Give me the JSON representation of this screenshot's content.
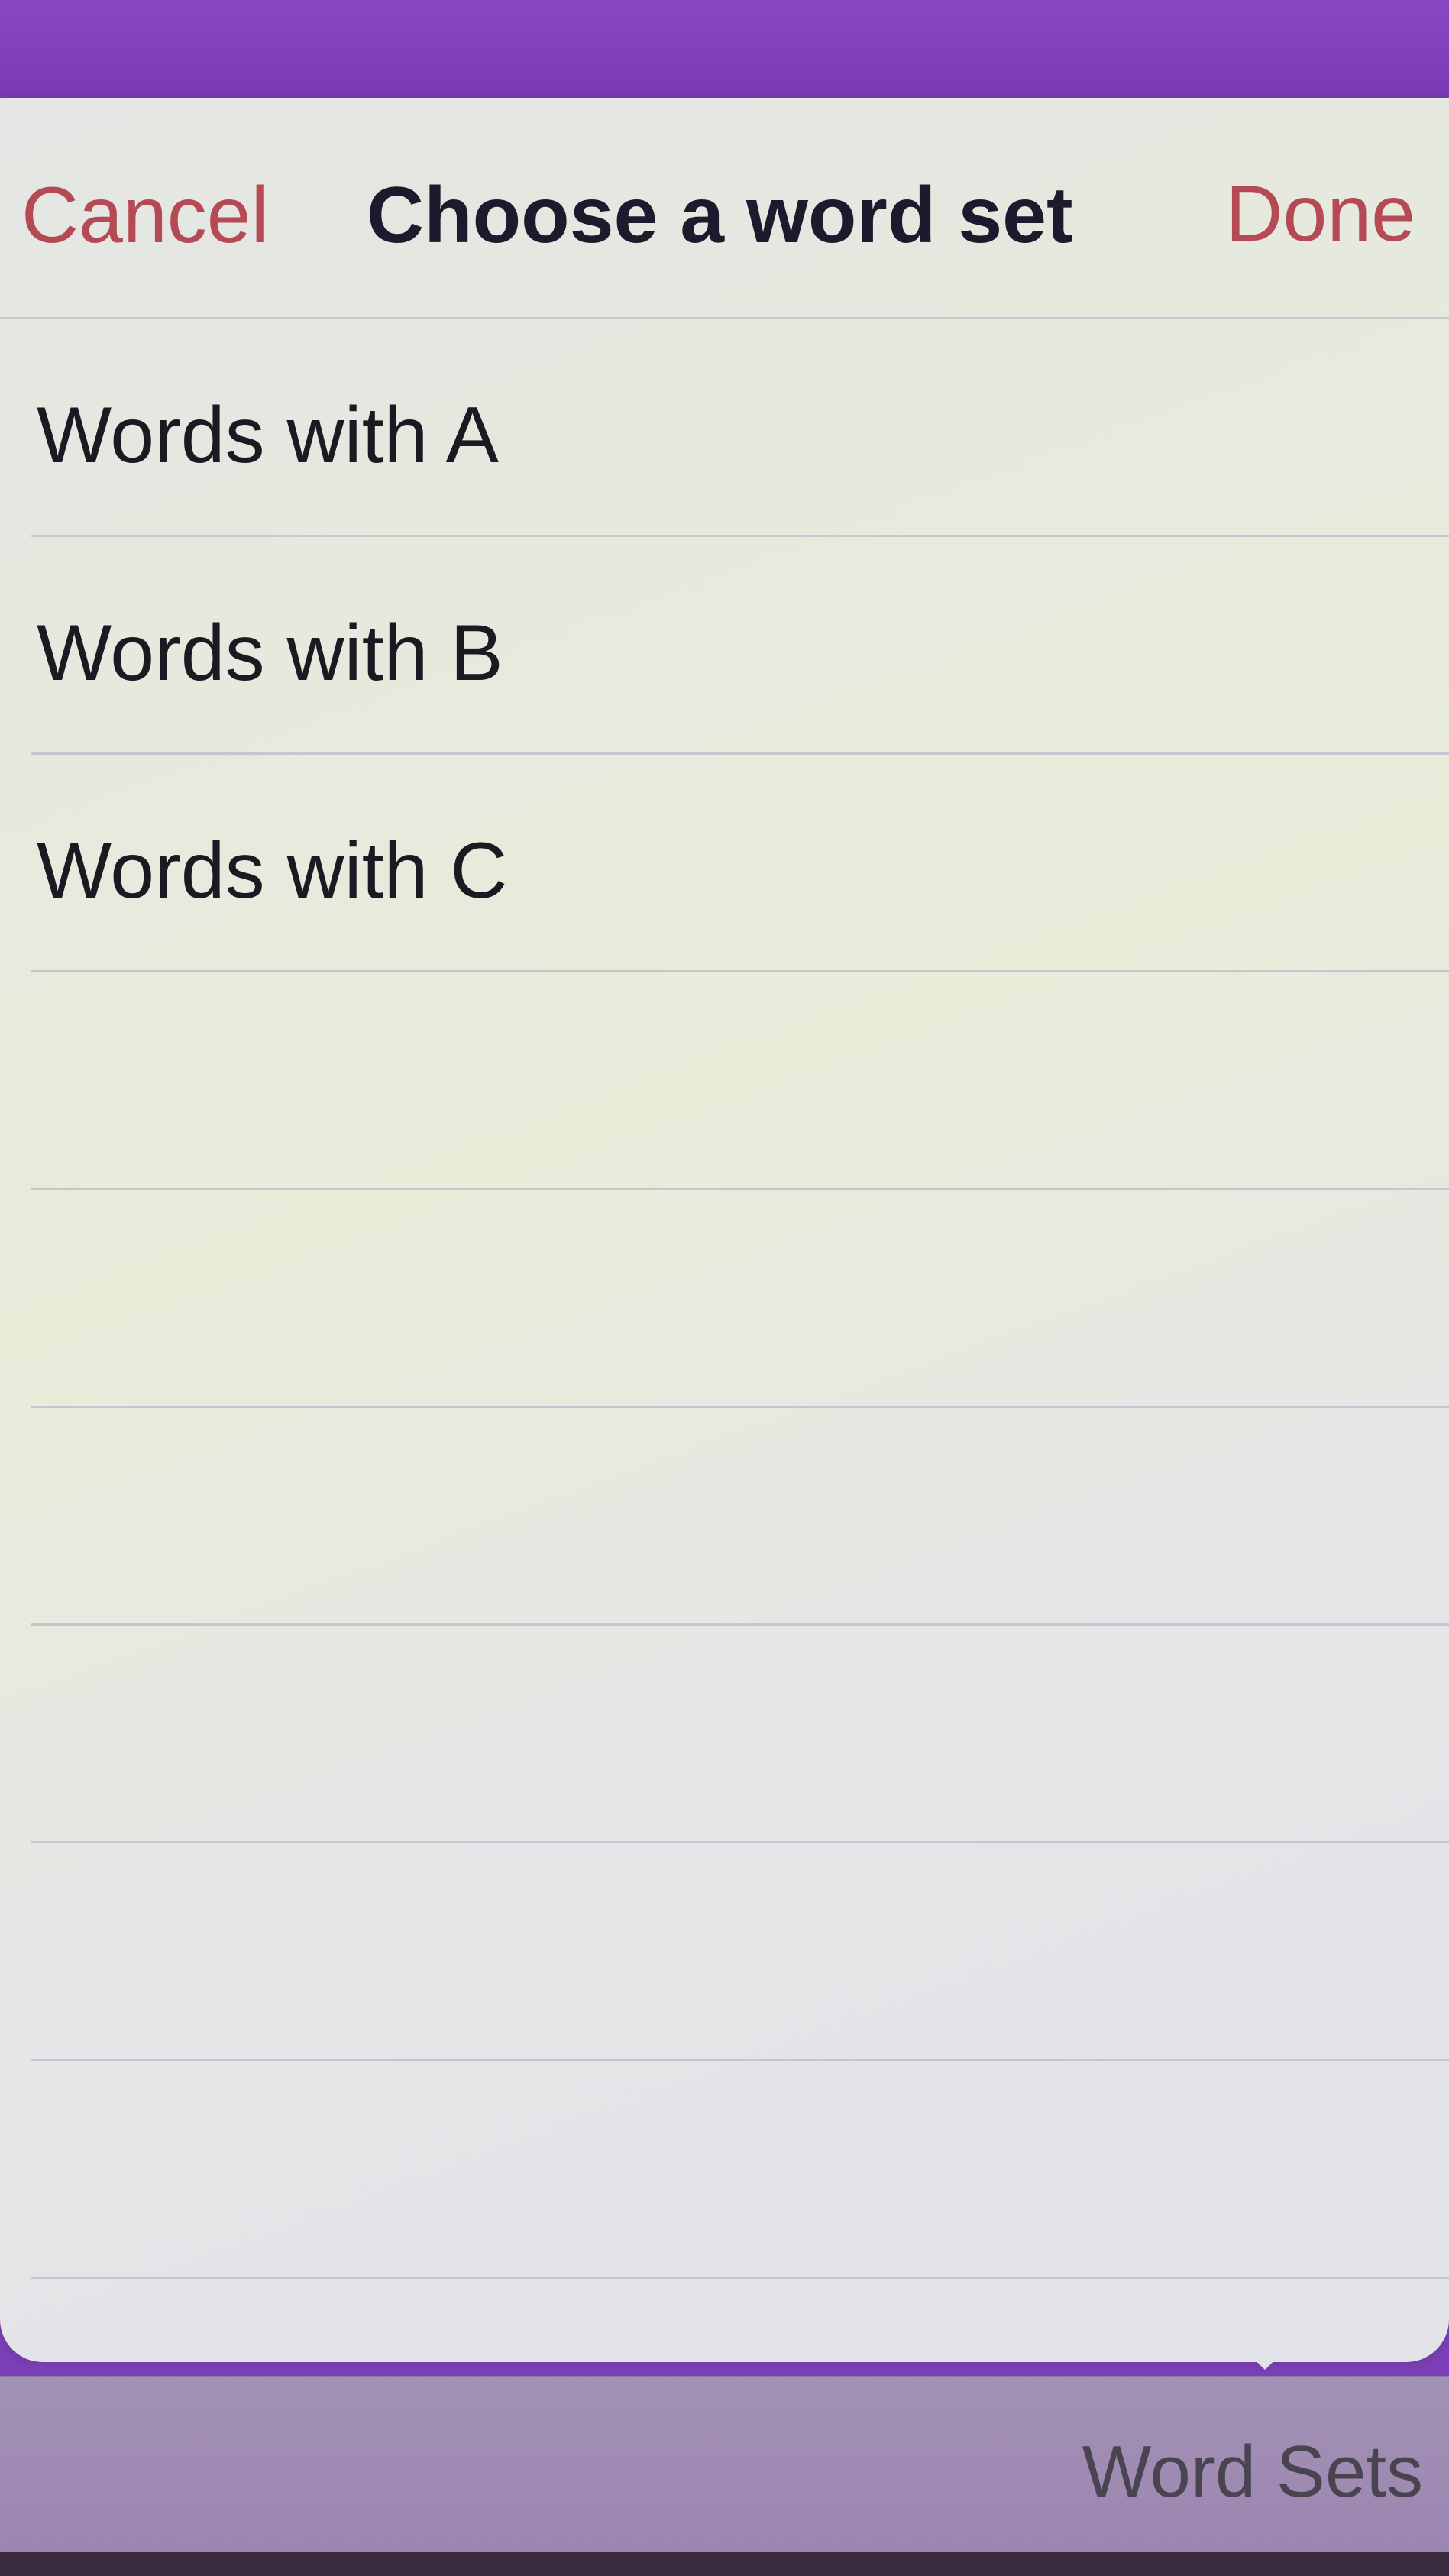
{
  "nav": {
    "cancel_label": "Cancel",
    "title": "Choose a word set",
    "done_label": "Done"
  },
  "word_sets": [
    {
      "label": "Words with A"
    },
    {
      "label": "Words with B"
    },
    {
      "label": "Words with C"
    }
  ],
  "toolbar": {
    "word_sets_label": "Word Sets"
  },
  "colors": {
    "accent": "#b54a55",
    "background": "#7b3fb6",
    "popover": "#e5e7e3",
    "toolbar": "#a08bb4"
  }
}
